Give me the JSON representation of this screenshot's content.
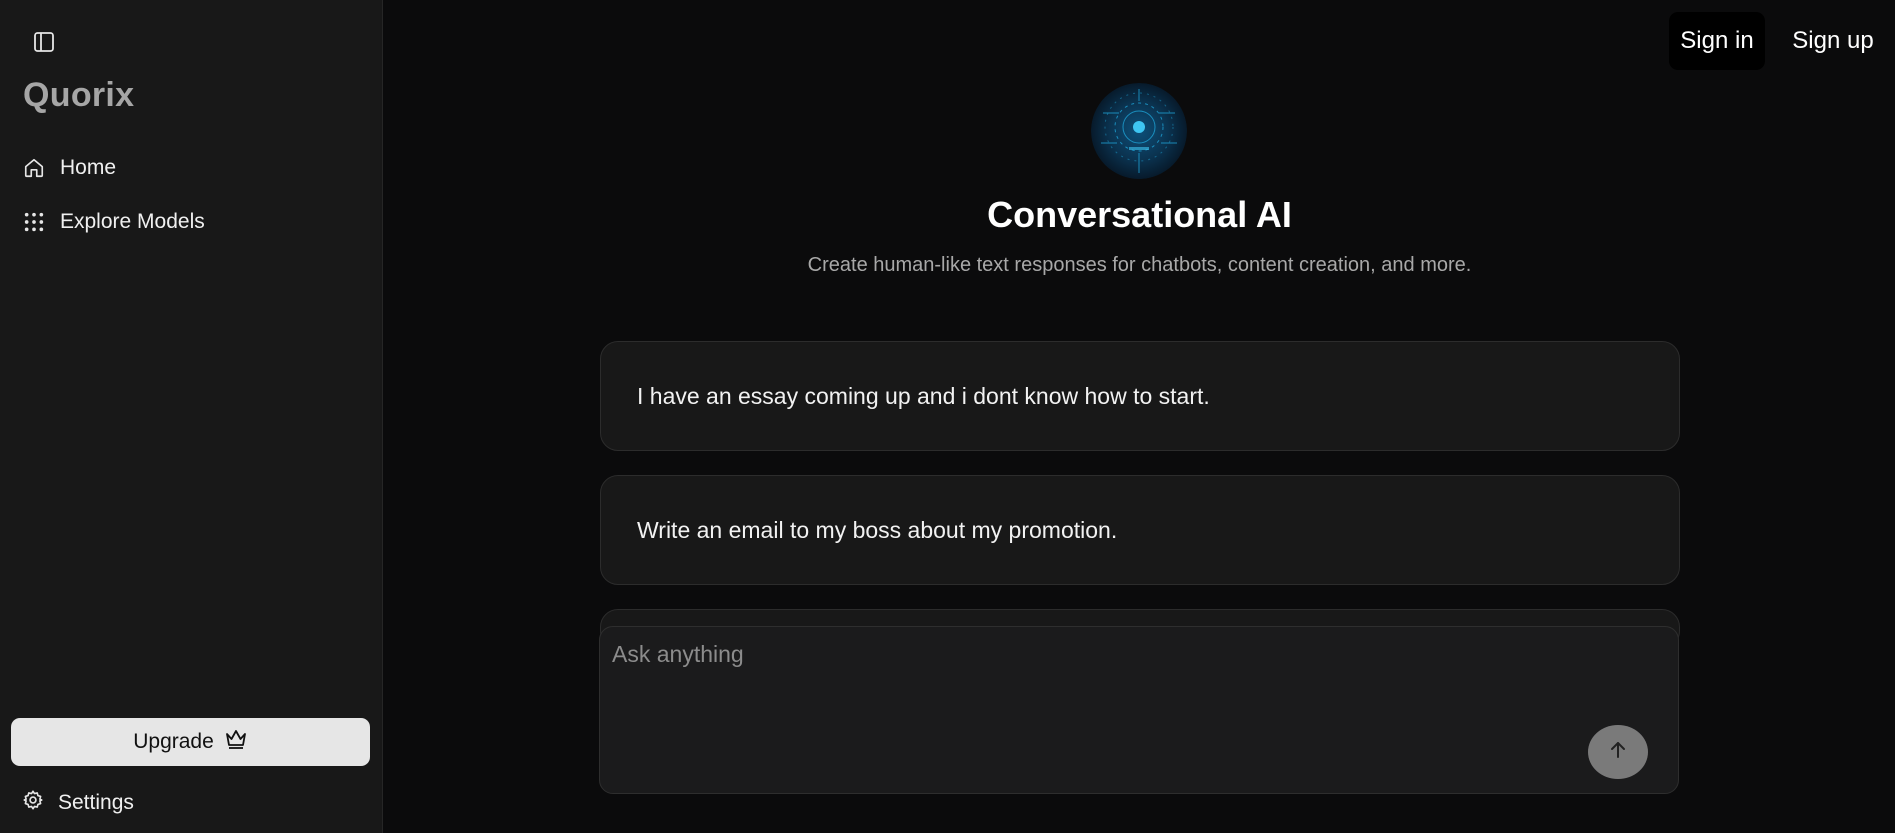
{
  "sidebar": {
    "brand": "Quorix",
    "items": [
      {
        "label": "Home",
        "icon": "home-icon"
      },
      {
        "label": "Explore Models",
        "icon": "grid-icon"
      }
    ],
    "upgrade_label": "Upgrade",
    "settings_label": "Settings"
  },
  "header": {
    "signin_label": "Sign in",
    "signup_label": "Sign up"
  },
  "hero": {
    "title": "Conversational AI",
    "subtitle": "Create human-like text responses for chatbots, content creation, and more."
  },
  "suggestions": [
    "I have an essay coming up and i dont know how to start.",
    "Write an email to my boss about my promotion."
  ],
  "composer": {
    "placeholder": "Ask anything"
  },
  "colors": {
    "sidebar_bg": "#181818",
    "main_bg": "#0b0b0c",
    "upgrade_bg": "#e6e6e6",
    "send_bg": "#7a7a7a",
    "avatar_accent": "#1fa3d6"
  }
}
